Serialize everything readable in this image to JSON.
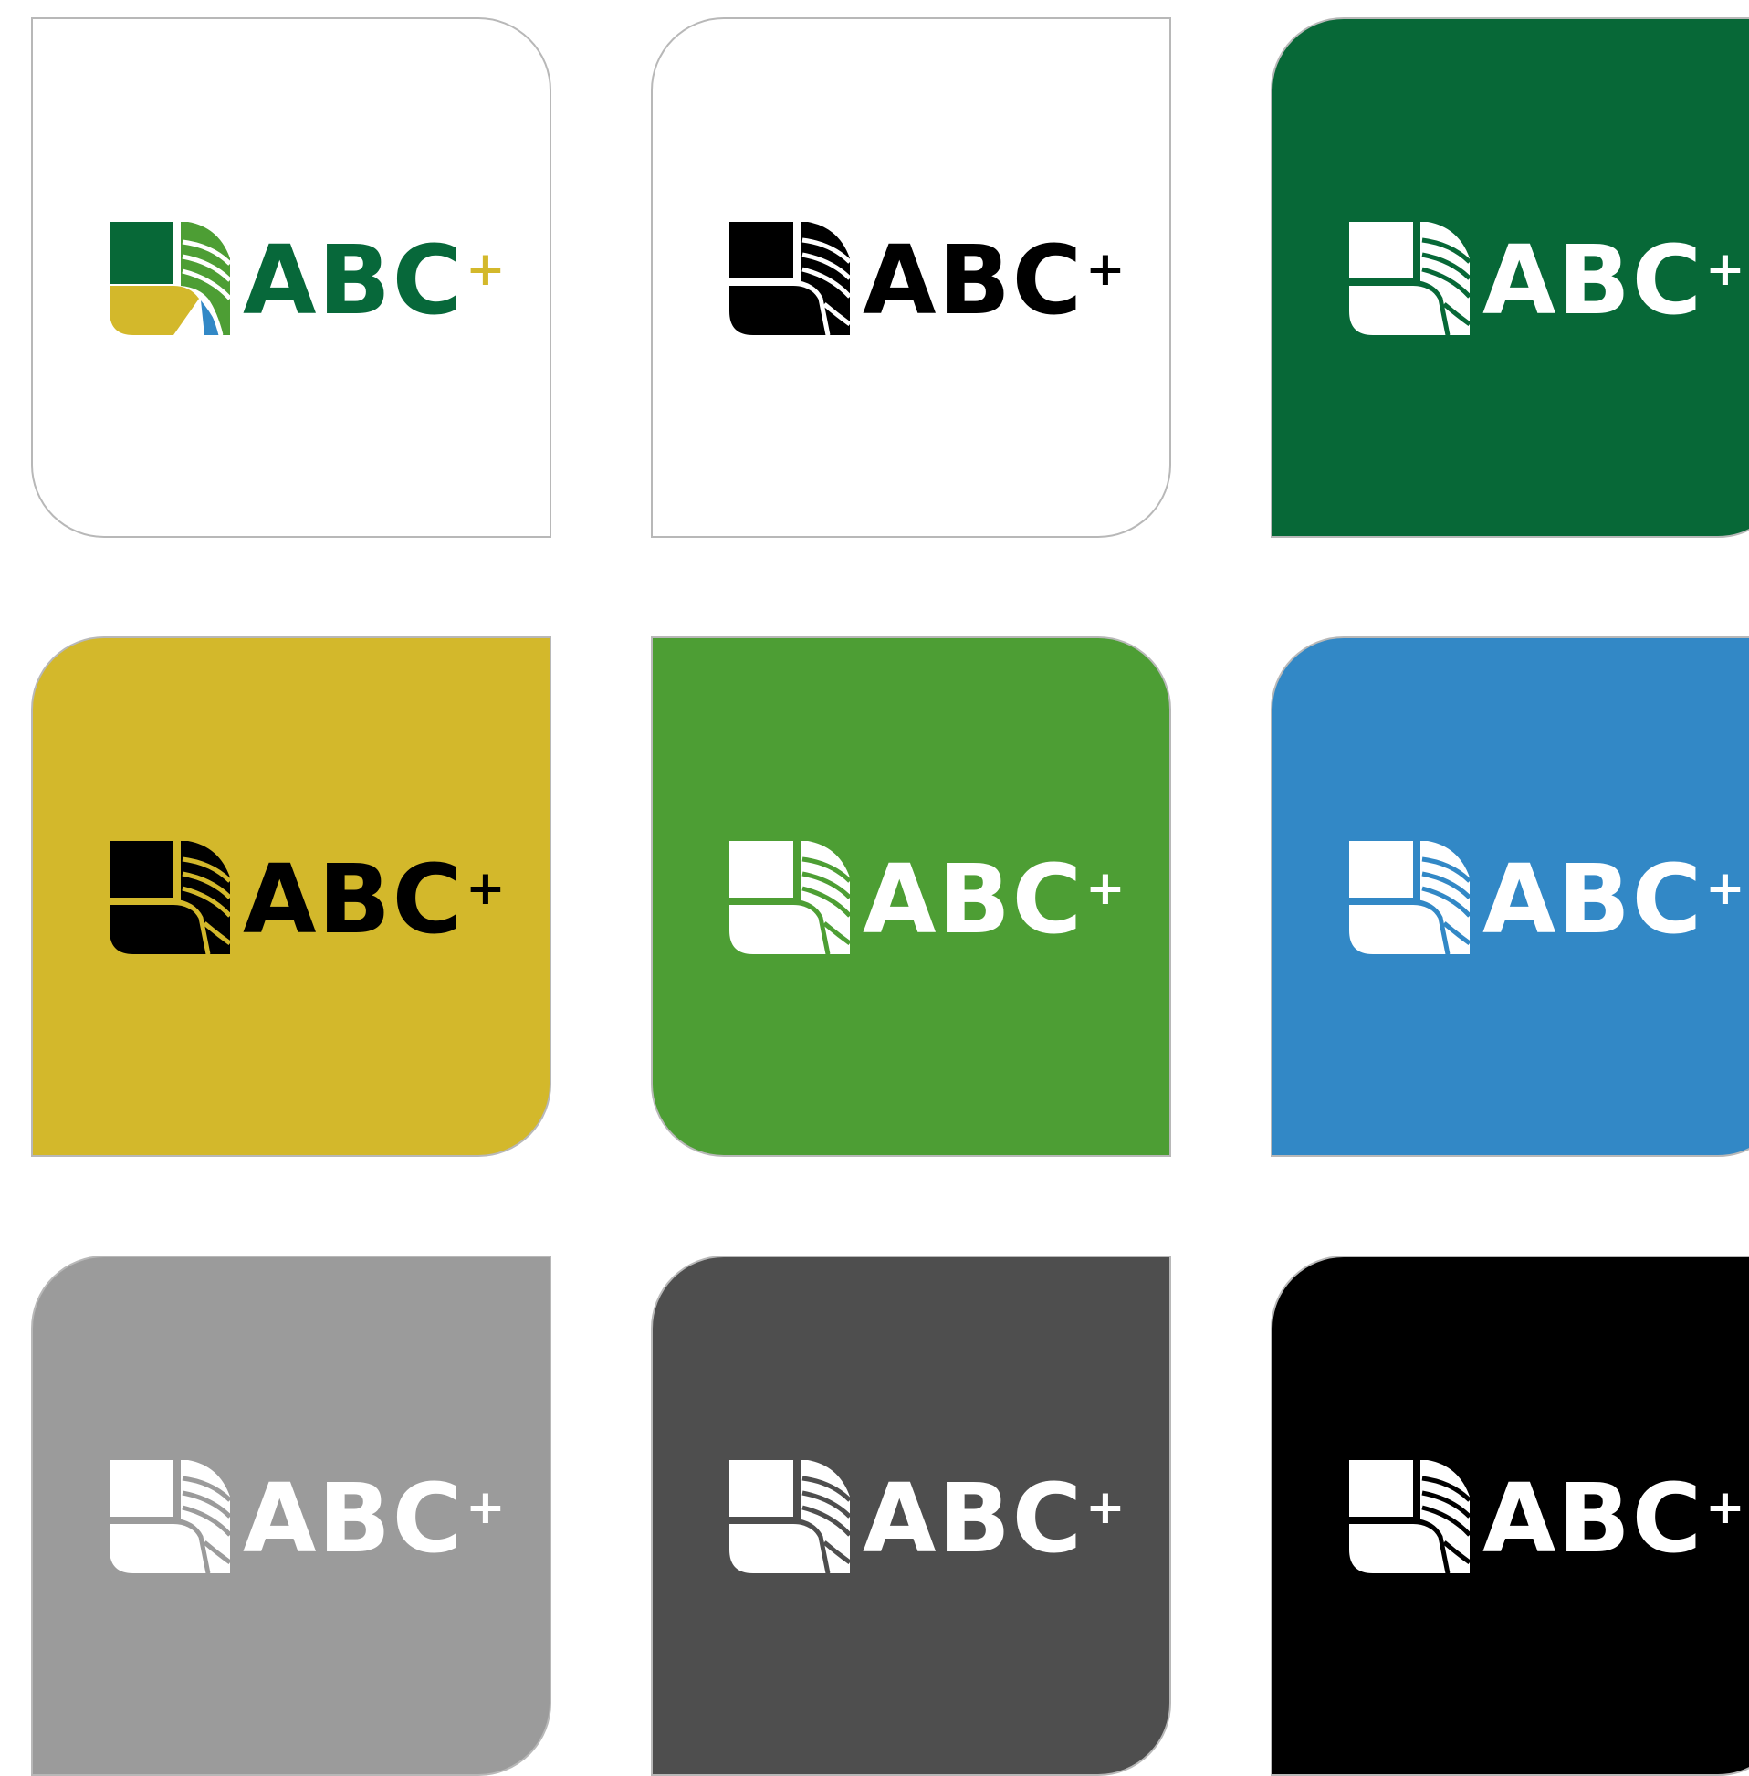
{
  "logo": {
    "name": "ABC",
    "suffix": "+"
  },
  "tiles": [
    {
      "id": "full-color-on-white",
      "background": "#ffffff",
      "ink": "full-color",
      "text_color": "#07683a",
      "plus_color": "#d4b82c"
    },
    {
      "id": "black-on-white",
      "background": "#ffffff",
      "ink": "#000000",
      "text_color": "#000000",
      "plus_color": "#000000"
    },
    {
      "id": "white-on-dark-green",
      "background": "#076837",
      "ink": "#ffffff",
      "text_color": "#ffffff",
      "plus_color": "#ffffff"
    },
    {
      "id": "black-on-gold",
      "background": "#d3b82b",
      "ink": "#000000",
      "text_color": "#000000",
      "plus_color": "#000000"
    },
    {
      "id": "white-on-green",
      "background": "#4d9e34",
      "ink": "#ffffff",
      "text_color": "#ffffff",
      "plus_color": "#ffffff"
    },
    {
      "id": "white-on-blue",
      "background": "#3288c6",
      "ink": "#ffffff",
      "text_color": "#ffffff",
      "plus_color": "#ffffff"
    },
    {
      "id": "white-on-light-gray",
      "background": "#9b9b9b",
      "ink": "#ffffff",
      "text_color": "#ffffff",
      "plus_color": "#ffffff"
    },
    {
      "id": "white-on-dark-gray",
      "background": "#4e4e4e",
      "ink": "#ffffff",
      "text_color": "#ffffff",
      "plus_color": "#ffffff"
    },
    {
      "id": "white-on-black",
      "background": "#000000",
      "ink": "#ffffff",
      "text_color": "#ffffff",
      "plus_color": "#ffffff"
    }
  ],
  "brand_colors": {
    "dark_green": "#076837",
    "green": "#4d9e34",
    "gold": "#d3b82b",
    "blue": "#3288c6"
  }
}
